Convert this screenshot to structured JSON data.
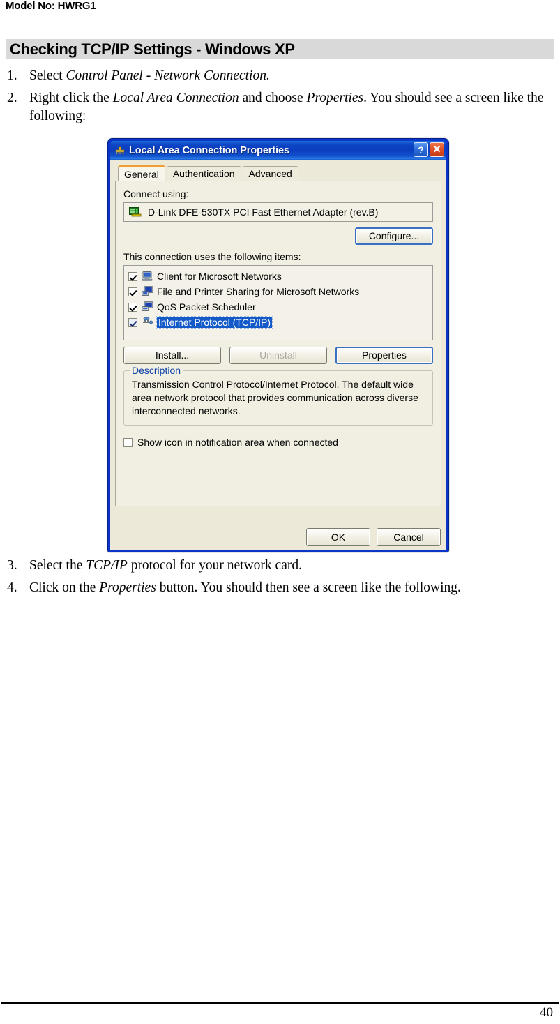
{
  "page": {
    "header_text": "Model No: HWRG1",
    "section_heading": "Checking TCP/IP Settings - Windows XP",
    "page_number": "40"
  },
  "steps_before": [
    {
      "num": "1.",
      "parts": [
        {
          "text": "Select ",
          "italic": false
        },
        {
          "text": "Control Panel - Network Connection.",
          "italic": true
        }
      ]
    },
    {
      "num": "2.",
      "parts": [
        {
          "text": "Right click the ",
          "italic": false
        },
        {
          "text": "Local Area Connection",
          "italic": true
        },
        {
          "text": " and choose ",
          "italic": false
        },
        {
          "text": "Properties",
          "italic": true
        },
        {
          "text": ". You should see a screen like the following:",
          "italic": false
        }
      ]
    }
  ],
  "steps_after": [
    {
      "num": "3.",
      "parts": [
        {
          "text": "Select the ",
          "italic": false
        },
        {
          "text": "TCP/IP",
          "italic": true
        },
        {
          "text": " protocol for your network card.",
          "italic": false
        }
      ]
    },
    {
      "num": "4.",
      "parts": [
        {
          "text": "Click on the ",
          "italic": false
        },
        {
          "text": "Properties",
          "italic": true
        },
        {
          "text": " button. You should then see a screen like the following.",
          "italic": false
        }
      ]
    }
  ],
  "dialog": {
    "title": "Local Area Connection Properties",
    "title_icon": "network-plug-icon",
    "help_button": "?",
    "close_button": "✕",
    "tabs": [
      {
        "label": "General",
        "active": true
      },
      {
        "label": "Authentication",
        "active": false
      },
      {
        "label": "Advanced",
        "active": false
      }
    ],
    "connect_using_label": "Connect using:",
    "adapter": {
      "name": "D-Link DFE-530TX PCI Fast Ethernet Adapter (rev.B)",
      "icon": "network-adapter-icon"
    },
    "configure_button": "Configure...",
    "items_label": "This connection uses the following items:",
    "items": [
      {
        "label": "Client for Microsoft Networks",
        "checked": true,
        "selected": false,
        "icon": "computer-client-icon"
      },
      {
        "label": "File and Printer Sharing for Microsoft Networks",
        "checked": true,
        "selected": false,
        "icon": "file-printer-sharing-icon"
      },
      {
        "label": "QoS Packet Scheduler",
        "checked": true,
        "selected": false,
        "icon": "qos-scheduler-icon"
      },
      {
        "label": "Internet Protocol (TCP/IP)",
        "checked": true,
        "selected": true,
        "icon": "protocol-icon"
      }
    ],
    "install_button": "Install...",
    "uninstall_button": "Uninstall",
    "properties_button": "Properties",
    "description_group_title": "Description",
    "description_text": "Transmission Control Protocol/Internet Protocol. The default wide area network protocol that provides communication across diverse interconnected networks.",
    "show_icon_checkbox": {
      "label": "Show icon in notification area when connected",
      "checked": false
    },
    "ok_button": "OK",
    "cancel_button": "Cancel"
  },
  "colors": {
    "title_bar_blue": "#0b3dbe",
    "dialog_face": "#ece9d8",
    "tab_panel": "#f1efe2",
    "selection_blue": "#1459c8",
    "group_title_blue": "#0b3fa8",
    "band_gray": "#d9d9d9",
    "tab_active_accent": "#f0a030"
  }
}
